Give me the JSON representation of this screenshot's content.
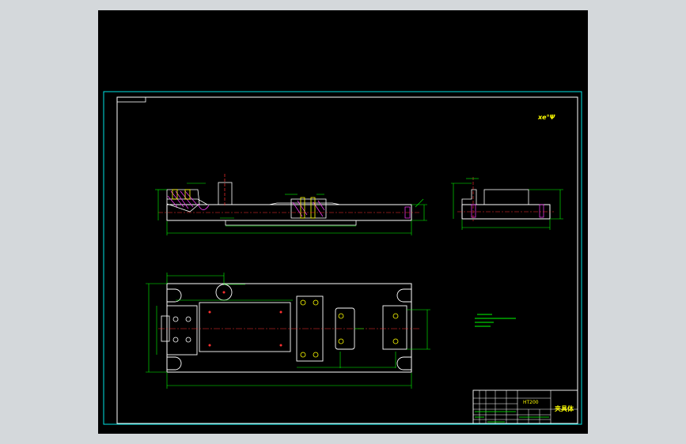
{
  "colors": {
    "background_outer": "#d4d8db",
    "canvas": "#000000",
    "frame": "#00e5e5",
    "border": "#ffffff",
    "geometry": "#ffffff",
    "dimension": "#00ff00",
    "hatch": "#ff3cff",
    "centerline": "#ff3030",
    "hole": "#ffff00",
    "title_note": "#ffff00"
  },
  "drawing": {
    "title_note": "xe°Ψ",
    "title_block_name": "夹具体",
    "title_block_code": "HT200"
  }
}
